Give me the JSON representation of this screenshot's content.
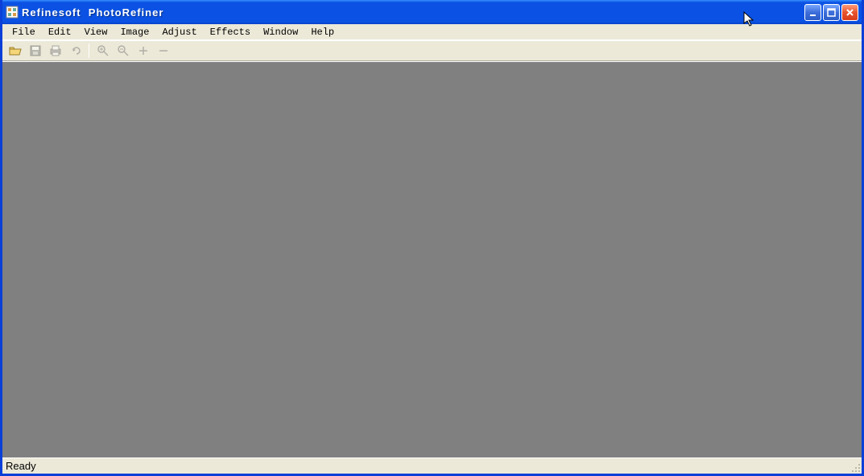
{
  "window_title": "Refinesoft  PhotoRefiner",
  "menus": {
    "file": "File",
    "edit": "Edit",
    "view": "View",
    "image": "Image",
    "adjust": "Adjust",
    "effects": "Effects",
    "window": "Window",
    "help": "Help"
  },
  "toolbar": {
    "open": "open-icon",
    "save": "save-icon",
    "print": "print-icon",
    "undo": "undo-icon",
    "zoom_in": "zoom-in-icon",
    "zoom_out": "zoom-out-icon",
    "plus": "plus-icon",
    "minus": "minus-icon"
  },
  "status_text": "Ready"
}
